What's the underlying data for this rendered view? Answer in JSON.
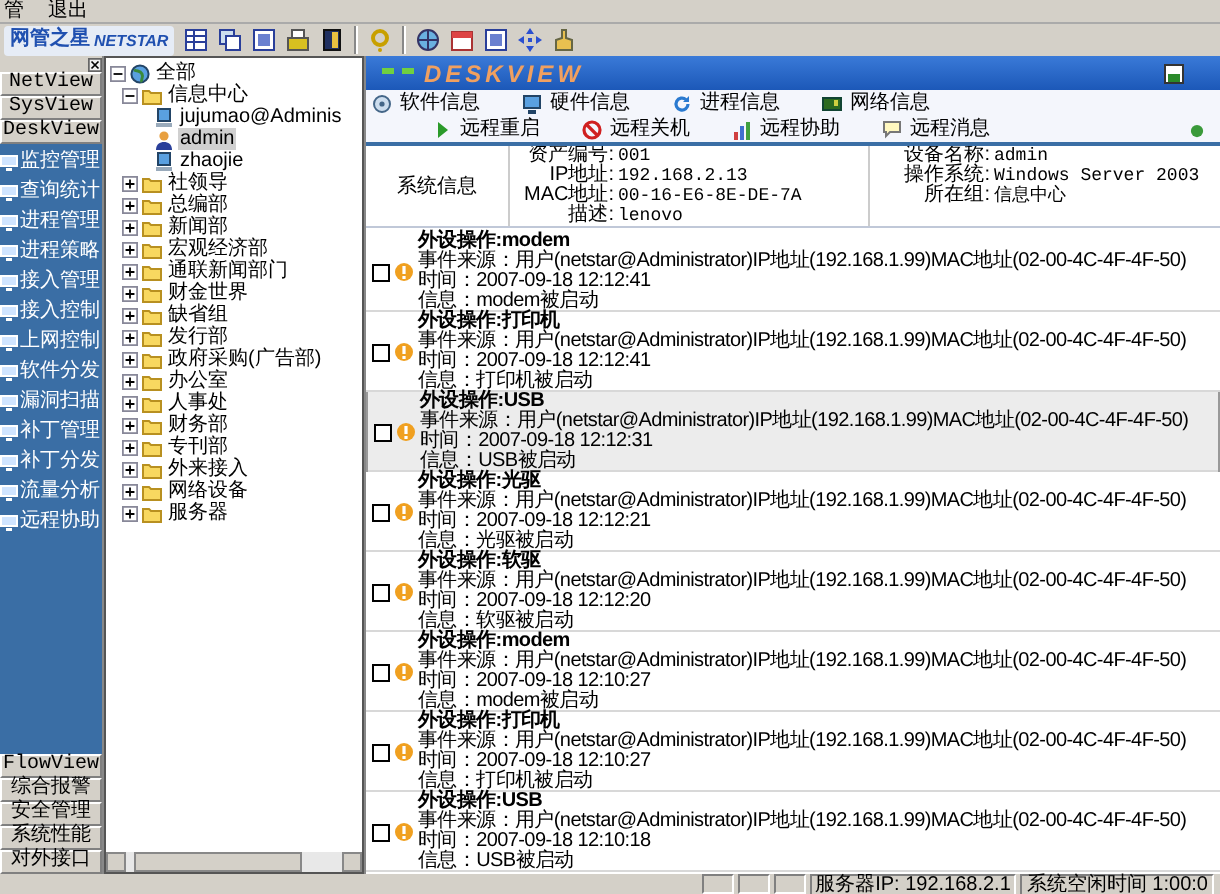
{
  "menu": [
    "管",
    "退出"
  ],
  "logo": {
    "title": "网管之星",
    "subtitle": "NETSTAR"
  },
  "sidebar": {
    "top_tabs": [
      "NetView",
      "SysView",
      "DeskView"
    ],
    "items": [
      {
        "label": "监控管理"
      },
      {
        "label": "查询统计"
      },
      {
        "label": "进程管理"
      },
      {
        "label": "进程策略"
      },
      {
        "label": "接入管理"
      },
      {
        "label": "接入控制"
      },
      {
        "label": "上网控制"
      },
      {
        "label": "软件分发"
      },
      {
        "label": "漏洞扫描"
      },
      {
        "label": "补丁管理"
      },
      {
        "label": "补丁分发"
      },
      {
        "label": "流量分析"
      },
      {
        "label": "远程协助"
      }
    ],
    "bottom_tabs": [
      "FlowView",
      "综合报警",
      "安全管理",
      "系统性能",
      "对外接口"
    ]
  },
  "tree": [
    {
      "label": "全部",
      "kind": "root",
      "expanded": true,
      "selected": false,
      "children": [
        {
          "label": "信息中心",
          "kind": "group",
          "expanded": true,
          "selected": false,
          "children": [
            {
              "label": "jujumao@Adminis",
              "kind": "computer",
              "selected": false
            },
            {
              "label": "admin",
              "kind": "user",
              "selected": true
            },
            {
              "label": "zhaojie",
              "kind": "computer",
              "selected": false
            }
          ]
        },
        {
          "label": "社领导",
          "kind": "group",
          "expanded": false,
          "selected": false
        },
        {
          "label": "总编部",
          "kind": "group",
          "expanded": false,
          "selected": false
        },
        {
          "label": "新闻部",
          "kind": "group",
          "expanded": false,
          "selected": false
        },
        {
          "label": "宏观经济部",
          "kind": "group",
          "expanded": false,
          "selected": false
        },
        {
          "label": "通联新闻部门",
          "kind": "group",
          "expanded": false,
          "selected": false
        },
        {
          "label": "财金世界",
          "kind": "group",
          "expanded": false,
          "selected": false
        },
        {
          "label": "缺省组",
          "kind": "group",
          "expanded": false,
          "selected": false
        },
        {
          "label": "发行部",
          "kind": "group",
          "expanded": false,
          "selected": false
        },
        {
          "label": "政府采购(广告部)",
          "kind": "group",
          "expanded": false,
          "selected": false
        },
        {
          "label": "办公室",
          "kind": "group",
          "expanded": false,
          "selected": false
        },
        {
          "label": "人事处",
          "kind": "group",
          "expanded": false,
          "selected": false
        },
        {
          "label": "财务部",
          "kind": "group",
          "expanded": false,
          "selected": false
        },
        {
          "label": "专刊部",
          "kind": "group",
          "expanded": false,
          "selected": false
        },
        {
          "label": "外来接入",
          "kind": "group",
          "expanded": false,
          "selected": false
        },
        {
          "label": "网络设备",
          "kind": "group",
          "expanded": false,
          "selected": false
        },
        {
          "label": "服务器",
          "kind": "group",
          "expanded": false,
          "selected": false
        }
      ]
    }
  ],
  "panel": {
    "title": "DESKVIEW",
    "actions": [
      [
        "软件信息",
        "硬件信息",
        "进程信息",
        "网络信息"
      ],
      [
        "远程重启",
        "远程关机",
        "远程协助",
        "远程消息"
      ]
    ],
    "info": {
      "section": "系统信息",
      "left": [
        {
          "key": "资产编号:",
          "value": "001"
        },
        {
          "key": "IP地址:",
          "value": "192.168.2.13"
        },
        {
          "key": "MAC地址:",
          "value": "00-16-E6-8E-DE-7A"
        },
        {
          "key": "描述:",
          "value": "lenovo"
        }
      ],
      "right": [
        {
          "key": "设备名称:",
          "value": "admin"
        },
        {
          "key": "操作系统:",
          "value": "Windows Server 2003"
        },
        {
          "key": "所在组:",
          "value": "信息中心"
        }
      ]
    }
  },
  "events": [
    {
      "title": "外设操作:modem",
      "source": "事件来源：用户(netstar@Administrator)IP地址(192.168.1.99)MAC地址(02-00-4C-4F-4F-50)",
      "time": "时间：2007-09-18 12:12:41",
      "info": "信息：modem被启动",
      "checked": false,
      "selected": false
    },
    {
      "title": "外设操作:打印机",
      "source": "事件来源：用户(netstar@Administrator)IP地址(192.168.1.99)MAC地址(02-00-4C-4F-4F-50)",
      "time": "时间：2007-09-18 12:12:41",
      "info": "信息：打印机被启动",
      "checked": false,
      "selected": false
    },
    {
      "title": "外设操作:USB",
      "source": "事件来源：用户(netstar@Administrator)IP地址(192.168.1.99)MAC地址(02-00-4C-4F-4F-50)",
      "time": "时间：2007-09-18 12:12:31",
      "info": "信息：USB被启动",
      "checked": false,
      "selected": true
    },
    {
      "title": "外设操作:光驱",
      "source": "事件来源：用户(netstar@Administrator)IP地址(192.168.1.99)MAC地址(02-00-4C-4F-4F-50)",
      "time": "时间：2007-09-18 12:12:21",
      "info": "信息：光驱被启动",
      "checked": false,
      "selected": false
    },
    {
      "title": "外设操作:软驱",
      "source": "事件来源：用户(netstar@Administrator)IP地址(192.168.1.99)MAC地址(02-00-4C-4F-4F-50)",
      "time": "时间：2007-09-18 12:12:20",
      "info": "信息：软驱被启动",
      "checked": false,
      "selected": false
    },
    {
      "title": "外设操作:modem",
      "source": "事件来源：用户(netstar@Administrator)IP地址(192.168.1.99)MAC地址(02-00-4C-4F-4F-50)",
      "time": "时间：2007-09-18 12:10:27",
      "info": "信息：modem被启动",
      "checked": false,
      "selected": false
    },
    {
      "title": "外设操作:打印机",
      "source": "事件来源：用户(netstar@Administrator)IP地址(192.168.1.99)MAC地址(02-00-4C-4F-4F-50)",
      "time": "时间：2007-09-18 12:10:27",
      "info": "信息：打印机被启动",
      "checked": false,
      "selected": false
    },
    {
      "title": "外设操作:USB",
      "source": "事件来源：用户(netstar@Administrator)IP地址(192.168.1.99)MAC地址(02-00-4C-4F-4F-50)",
      "time": "时间：2007-09-18 12:10:18",
      "info": "信息：USB被启动",
      "checked": false,
      "selected": false
    }
  ],
  "status_bar": [
    "服务器IP: 192.168.2.1",
    "系统空闲时间 1:00:0"
  ]
}
